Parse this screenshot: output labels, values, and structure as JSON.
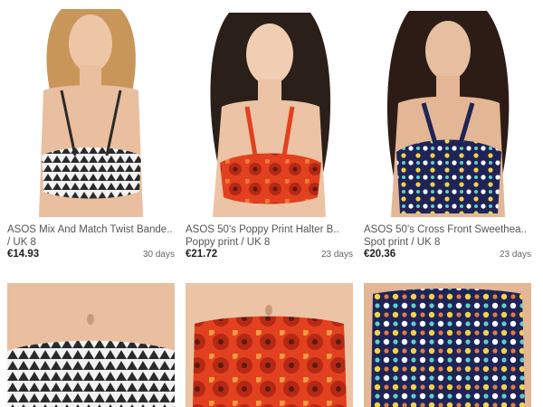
{
  "colors": {
    "background": "#ffffff",
    "price_text": "#222222",
    "title_text": "#555555",
    "skin": "#e9bf9f",
    "red_print": "#e2401f",
    "navy_spot": "#1f2456",
    "mono_print": "#2a2a2a"
  },
  "products": [
    {
      "title_line1": "ASOS Mix And Match Twist Bande..",
      "title_line2": "/ UK 8",
      "price": "€14.93",
      "days": "30 days",
      "image_icon": "bikini-top-mono-print"
    },
    {
      "title_line1": "ASOS 50's Poppy Print Halter B..",
      "title_line2": "Poppy print / UK 8",
      "price": "€21.72",
      "days": "23 days",
      "image_icon": "bikini-top-poppy-print"
    },
    {
      "title_line1": "ASOS 50's Cross Front Sweethea..",
      "title_line2": "Spot print / UK 8",
      "price": "€20.36",
      "days": "23 days",
      "image_icon": "bikini-top-spot-print"
    },
    {
      "image_icon": "bikini-bottom-mono-print"
    },
    {
      "image_icon": "bikini-bottom-poppy-print"
    },
    {
      "image_icon": "bikini-bottom-spot-print"
    }
  ]
}
